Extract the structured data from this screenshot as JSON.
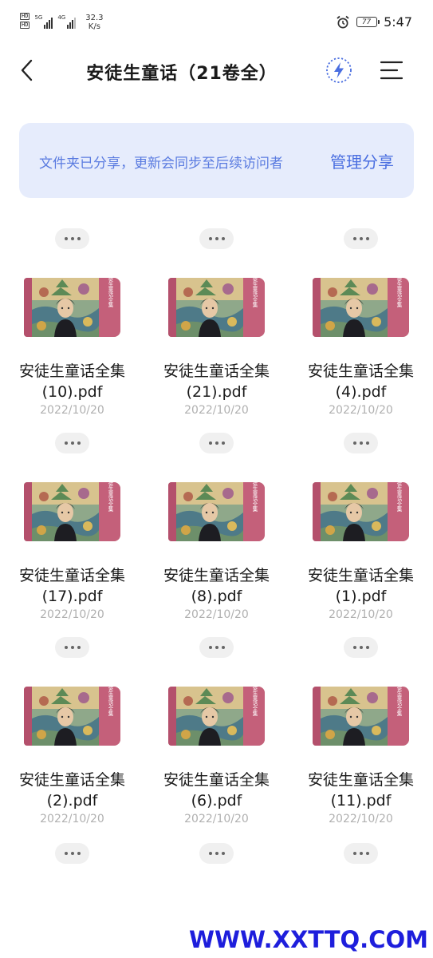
{
  "status_bar": {
    "sim1": "HD",
    "sim2": "HD",
    "net1": "5G",
    "net2": "4G",
    "speed_value": "32.3",
    "speed_unit": "K/s",
    "battery": "77",
    "time": "5:47"
  },
  "header": {
    "title": "安徒生童话（21卷全）",
    "back_icon": "chevron-left-icon",
    "flash_icon": "lightning-icon",
    "menu_icon": "hamburger-menu-icon"
  },
  "banner": {
    "text": "文件夹已分享，更新会同步至后续访问者",
    "button": "管理分享"
  },
  "files": [
    {
      "name": "安徒生童话全集(10).pdf",
      "line1": "安徒生童话全集",
      "line2": "(10).pdf",
      "date": "2022/10/20"
    },
    {
      "name": "安徒生童话全集(21).pdf",
      "line1": "安徒生童话全集",
      "line2": "(21).pdf",
      "date": "2022/10/20"
    },
    {
      "name": "安徒生童话全集(4).pdf",
      "line1": "安徒生童话全集",
      "line2": "(4).pdf",
      "date": "2022/10/20"
    },
    {
      "name": "安徒生童话全集(17).pdf",
      "line1": "安徒生童话全集",
      "line2": "(17).pdf",
      "date": "2022/10/20"
    },
    {
      "name": "安徒生童话全集(8).pdf",
      "line1": "安徒生童话全集",
      "line2": "(8).pdf",
      "date": "2022/10/20"
    },
    {
      "name": "安徒生童话全集(1).pdf",
      "line1": "安徒生童话全集",
      "line2": "(1).pdf",
      "date": "2022/10/20"
    },
    {
      "name": "安徒生童话全集(2).pdf",
      "line1": "安徒生童话全集",
      "line2": "(2).pdf",
      "date": "2022/10/20"
    },
    {
      "name": "安徒生童话全集(6).pdf",
      "line1": "安徒生童话全集",
      "line2": "(6).pdf",
      "date": "2022/10/20"
    },
    {
      "name": "安徒生童话全集(11).pdf",
      "line1": "安徒生童话全集",
      "line2": "(11).pdf",
      "date": "2022/10/20"
    }
  ],
  "cover": {
    "spine_text": "安徒生童话全集"
  },
  "watermark": "WWW.XXTTQ.COM",
  "colors": {
    "accent": "#4a6ee0",
    "banner_bg": "#e6ecfc",
    "cover_spine": "#c4607a",
    "watermark": "#1e1edc"
  }
}
